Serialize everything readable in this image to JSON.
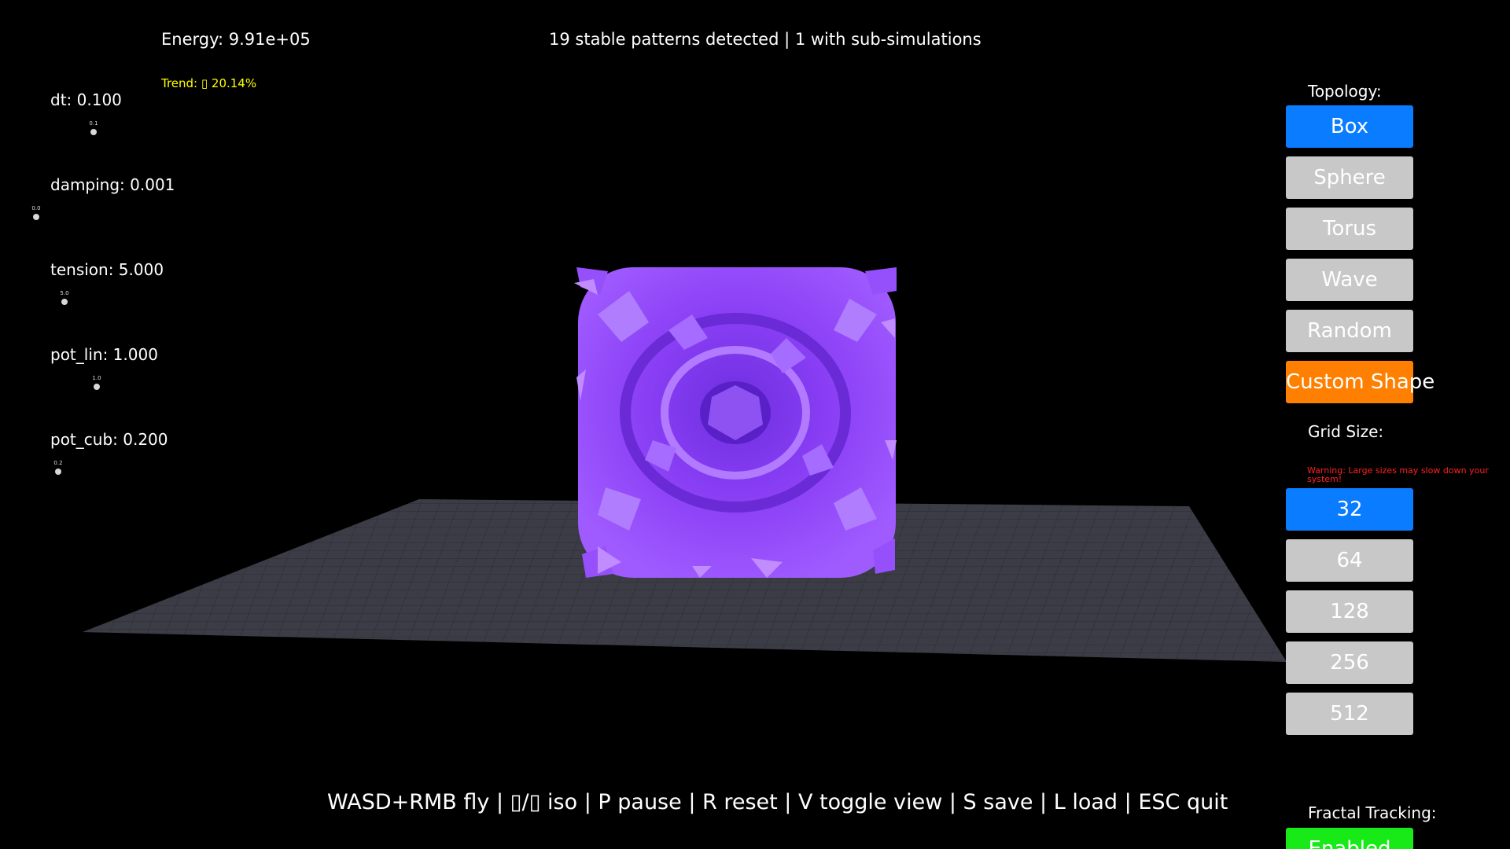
{
  "hud": {
    "energy": "Energy: 9.91e+05",
    "trend": "Trend: ▯ 20.14%",
    "status": "19 stable patterns detected | 1 with sub-simulations",
    "help": "WASD+RMB fly | ▯/▯ iso | P pause | R reset | V toggle view | S save | L load | ESC quit"
  },
  "params": [
    {
      "label": "dt: 0.100",
      "knob_value": "0.1"
    },
    {
      "label": "damping: 0.001",
      "knob_value": "0.0"
    },
    {
      "label": "tension: 5.000",
      "knob_value": "5.0"
    },
    {
      "label": "pot_lin: 1.000",
      "knob_value": "1.0"
    },
    {
      "label": "pot_cub: 0.200",
      "knob_value": "0.2"
    }
  ],
  "topology": {
    "label": "Topology:",
    "options": [
      "Box",
      "Sphere",
      "Torus",
      "Wave",
      "Random",
      "Custom Shape"
    ],
    "selected": "Box"
  },
  "grid_size": {
    "label": "Grid Size:",
    "warning": "Warning: Large sizes may slow down your system!",
    "options": [
      "32",
      "64",
      "128",
      "256",
      "512"
    ],
    "selected": "32"
  },
  "fractal_tracking": {
    "label": "Fractal Tracking:",
    "button": "Enabled"
  },
  "colors": {
    "background": "#000000",
    "floor": "#3c3c46",
    "blob": "#8a3ff5",
    "active_button": "#0a7cff",
    "inactive_button": "#c8c8c8",
    "custom_button": "#ff7f00",
    "enabled_button": "#17ea17",
    "trend_text": "#ffff00",
    "warning_text": "#ff2020"
  }
}
